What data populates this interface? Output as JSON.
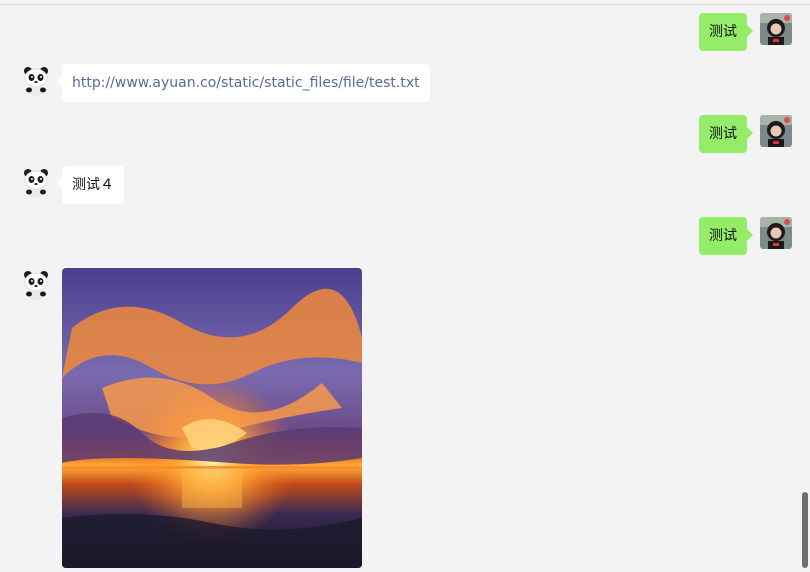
{
  "messages": [
    {
      "from": "self",
      "text": "测试"
    },
    {
      "from": "other",
      "text": "http://www.ayuan.co/static/static_files/file/test.txt"
    },
    {
      "from": "self",
      "text": "测试"
    },
    {
      "from": "other",
      "text": "测试４"
    },
    {
      "from": "self",
      "text": "测试"
    },
    {
      "from": "other",
      "type": "image",
      "image_icon": "sunset-clouds-painting"
    }
  ],
  "icons": {
    "self_avatar": "girl-portrait-avatar",
    "other_avatar": "panda-avatar"
  },
  "colors": {
    "background": "#f3f3f3",
    "self_bubble": "#95ec69",
    "other_bubble": "#ffffff",
    "link_text": "#576b95"
  }
}
